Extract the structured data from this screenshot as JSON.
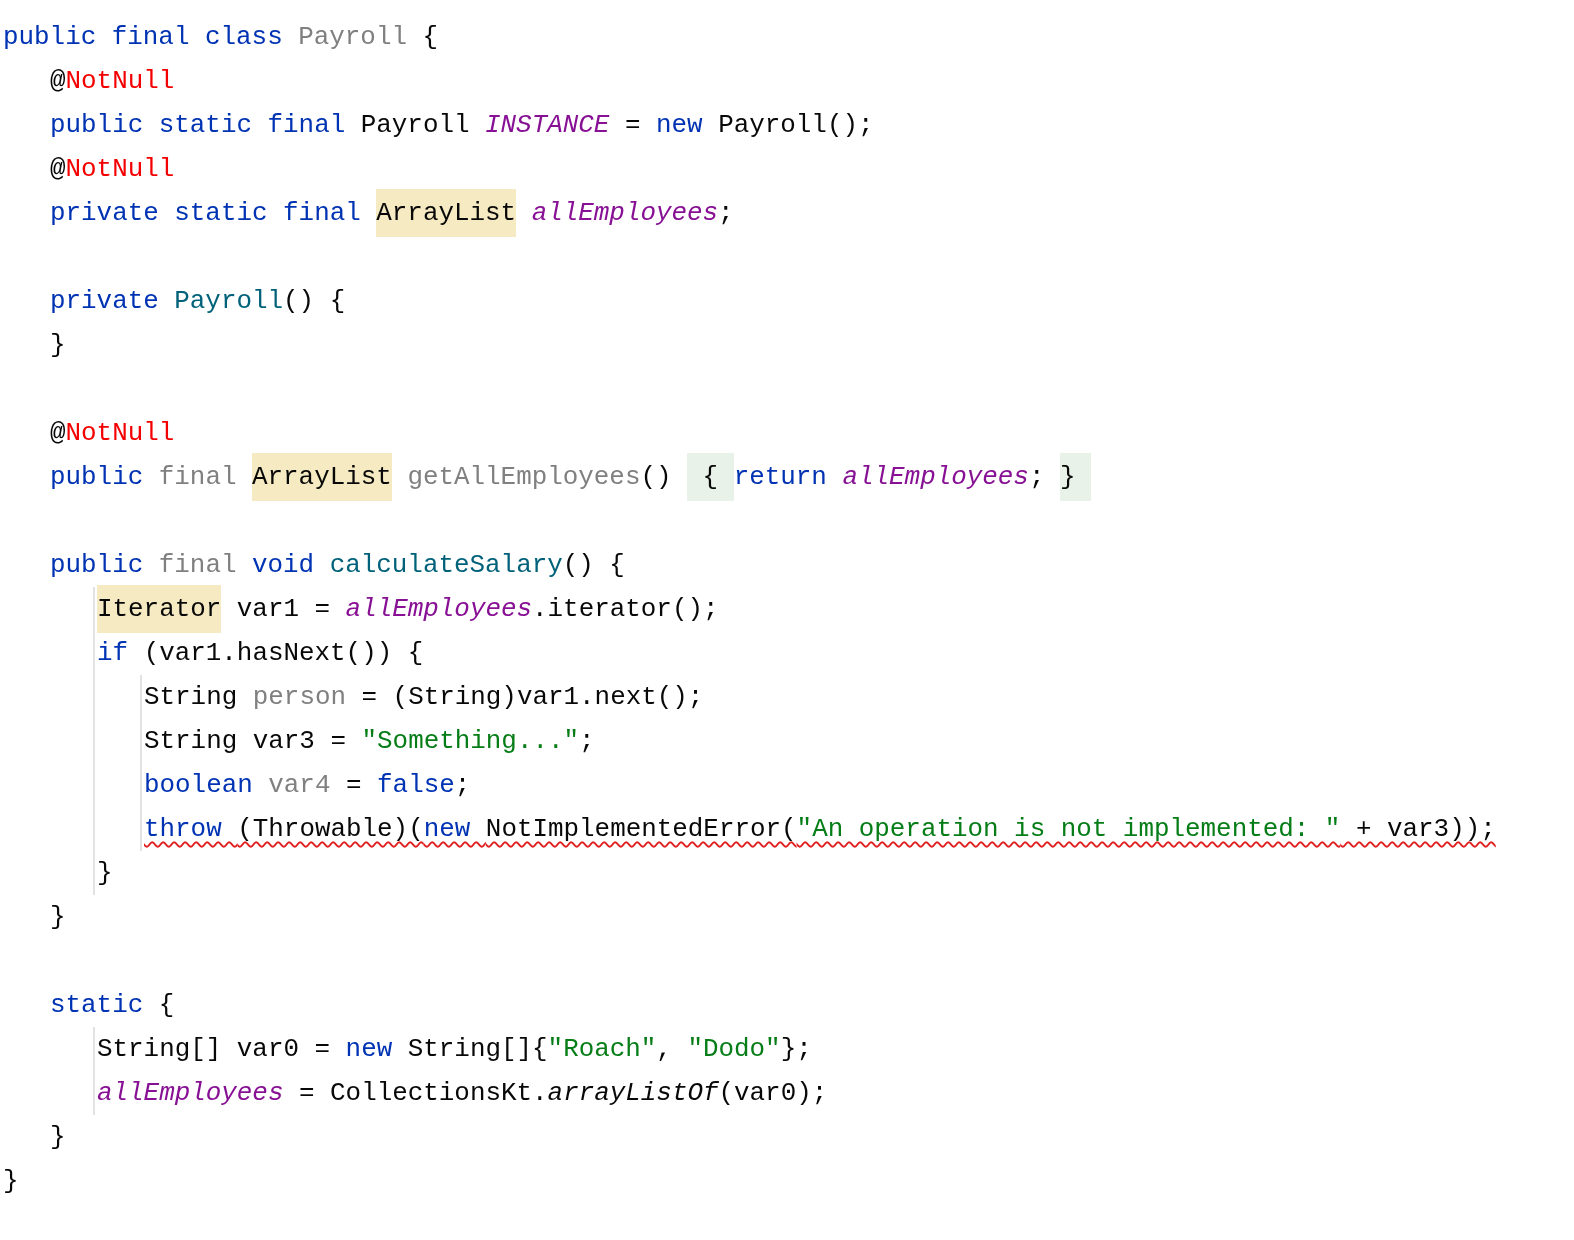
{
  "code": [
    {
      "kind": "code",
      "error": false,
      "tokens": [
        {
          "text": "public final class ",
          "kind": "keyword"
        },
        {
          "text": "Payroll",
          "kind": "unused"
        },
        {
          "text": " {",
          "kind": "plain"
        }
      ],
      "guide": false,
      "children": [
        {
          "kind": "code",
          "error": false,
          "tokens": [
            {
              "text": "@",
              "kind": "plain"
            },
            {
              "text": "NotNull",
              "kind": "annotation"
            }
          ]
        },
        {
          "kind": "code",
          "error": false,
          "tokens": [
            {
              "text": "public static final ",
              "kind": "keyword"
            },
            {
              "text": "Payroll ",
              "kind": "plain"
            },
            {
              "text": "INSTANCE",
              "kind": "field"
            },
            {
              "text": " = ",
              "kind": "plain"
            },
            {
              "text": "new ",
              "kind": "keyword"
            },
            {
              "text": "Payroll();",
              "kind": "plain"
            }
          ]
        },
        {
          "kind": "code",
          "error": false,
          "tokens": [
            {
              "text": "@",
              "kind": "plain"
            },
            {
              "text": "NotNull",
              "kind": "annotation"
            }
          ]
        },
        {
          "kind": "code",
          "error": false,
          "tokens": [
            {
              "text": "private static final ",
              "kind": "keyword"
            },
            {
              "text": "ArrayList",
              "kind": "type-usage"
            },
            {
              "text": " allEmployees",
              "kind": "field"
            },
            {
              "text": ";",
              "kind": "plain"
            }
          ]
        },
        {
          "kind": "blank"
        },
        {
          "kind": "code",
          "error": false,
          "tokens": [
            {
              "text": "private ",
              "kind": "keyword"
            },
            {
              "text": "Payroll",
              "kind": "method"
            },
            {
              "text": "() {",
              "kind": "plain"
            }
          ]
        },
        {
          "kind": "code",
          "error": false,
          "tokens": [
            {
              "text": "}",
              "kind": "plain"
            }
          ]
        },
        {
          "kind": "blank"
        },
        {
          "kind": "code",
          "error": false,
          "tokens": [
            {
              "text": "@",
              "kind": "plain"
            },
            {
              "text": "NotNull",
              "kind": "annotation"
            }
          ]
        },
        {
          "kind": "code",
          "error": false,
          "tokens": [
            {
              "text": "public ",
              "kind": "keyword"
            },
            {
              "text": "final ",
              "kind": "unused"
            },
            {
              "text": "ArrayList",
              "kind": "type-usage"
            },
            {
              "text": " getAllEmployees",
              "kind": "unused"
            },
            {
              "text": "() ",
              "kind": "plain"
            },
            {
              "text": " { ",
              "kind": "brace-match"
            },
            {
              "text": "return ",
              "kind": "keyword"
            },
            {
              "text": "allEmployees",
              "kind": "field"
            },
            {
              "text": "; ",
              "kind": "plain"
            },
            {
              "text": "} ",
              "kind": "brace-match"
            }
          ]
        },
        {
          "kind": "blank"
        },
        {
          "kind": "code",
          "error": false,
          "tokens": [
            {
              "text": "public ",
              "kind": "keyword"
            },
            {
              "text": "final ",
              "kind": "unused"
            },
            {
              "text": "void ",
              "kind": "keyword"
            },
            {
              "text": "calculateSalary",
              "kind": "method"
            },
            {
              "text": "() {",
              "kind": "plain"
            }
          ],
          "guide": true,
          "children": [
            {
              "kind": "code",
              "error": false,
              "tokens": [
                {
                  "text": "Iterator",
                  "kind": "type-usage"
                },
                {
                  "text": " var1 = ",
                  "kind": "plain"
                },
                {
                  "text": "allEmployees",
                  "kind": "field"
                },
                {
                  "text": ".iterator();",
                  "kind": "plain"
                }
              ]
            },
            {
              "kind": "code",
              "error": false,
              "tokens": [
                {
                  "text": "if ",
                  "kind": "keyword"
                },
                {
                  "text": "(var1.hasNext()) {",
                  "kind": "plain"
                }
              ],
              "guide": true,
              "children": [
                {
                  "kind": "code",
                  "error": false,
                  "tokens": [
                    {
                      "text": "String ",
                      "kind": "plain"
                    },
                    {
                      "text": "person",
                      "kind": "unused"
                    },
                    {
                      "text": " = (String)var1.next();",
                      "kind": "plain"
                    }
                  ]
                },
                {
                  "kind": "code",
                  "error": false,
                  "tokens": [
                    {
                      "text": "String var3 = ",
                      "kind": "plain"
                    },
                    {
                      "text": "\"Something...\"",
                      "kind": "string"
                    },
                    {
                      "text": ";",
                      "kind": "plain"
                    }
                  ]
                },
                {
                  "kind": "code",
                  "error": false,
                  "tokens": [
                    {
                      "text": "boolean ",
                      "kind": "keyword"
                    },
                    {
                      "text": "var4",
                      "kind": "unused"
                    },
                    {
                      "text": " = ",
                      "kind": "plain"
                    },
                    {
                      "text": "false",
                      "kind": "keyword"
                    },
                    {
                      "text": ";",
                      "kind": "plain"
                    }
                  ]
                },
                {
                  "kind": "code",
                  "error": true,
                  "tokens": [
                    {
                      "text": "throw ",
                      "kind": "keyword"
                    },
                    {
                      "text": "(Throwable)(",
                      "kind": "plain"
                    },
                    {
                      "text": "new ",
                      "kind": "keyword"
                    },
                    {
                      "text": "NotImplementedError(",
                      "kind": "plain"
                    },
                    {
                      "text": "\"An operation is not implemented: \"",
                      "kind": "string"
                    },
                    {
                      "text": " + var3));",
                      "kind": "plain"
                    }
                  ]
                }
              ]
            },
            {
              "kind": "code",
              "error": false,
              "tokens": [
                {
                  "text": "}",
                  "kind": "plain"
                }
              ]
            }
          ]
        },
        {
          "kind": "code",
          "error": false,
          "tokens": [
            {
              "text": "}",
              "kind": "plain"
            }
          ]
        },
        {
          "kind": "blank"
        },
        {
          "kind": "code",
          "error": false,
          "tokens": [
            {
              "text": "static ",
              "kind": "keyword"
            },
            {
              "text": "{",
              "kind": "plain"
            }
          ],
          "guide": true,
          "children": [
            {
              "kind": "code",
              "error": false,
              "tokens": [
                {
                  "text": "String[] var0 = ",
                  "kind": "plain"
                },
                {
                  "text": "new ",
                  "kind": "keyword"
                },
                {
                  "text": "String[]{",
                  "kind": "plain"
                },
                {
                  "text": "\"Roach\"",
                  "kind": "string"
                },
                {
                  "text": ", ",
                  "kind": "plain"
                },
                {
                  "text": "\"Dodo\"",
                  "kind": "string"
                },
                {
                  "text": "};",
                  "kind": "plain"
                }
              ]
            },
            {
              "kind": "code",
              "error": false,
              "tokens": [
                {
                  "text": "allEmployees",
                  "kind": "field"
                },
                {
                  "text": " = CollectionsKt.",
                  "kind": "plain"
                },
                {
                  "text": "arrayListOf",
                  "kind": "static-call"
                },
                {
                  "text": "(var0);",
                  "kind": "plain"
                }
              ]
            }
          ]
        },
        {
          "kind": "code",
          "error": false,
          "tokens": [
            {
              "text": "}",
              "kind": "plain"
            }
          ]
        }
      ]
    },
    {
      "kind": "code",
      "error": false,
      "tokens": [
        {
          "text": "}",
          "kind": "plain"
        }
      ]
    }
  ]
}
